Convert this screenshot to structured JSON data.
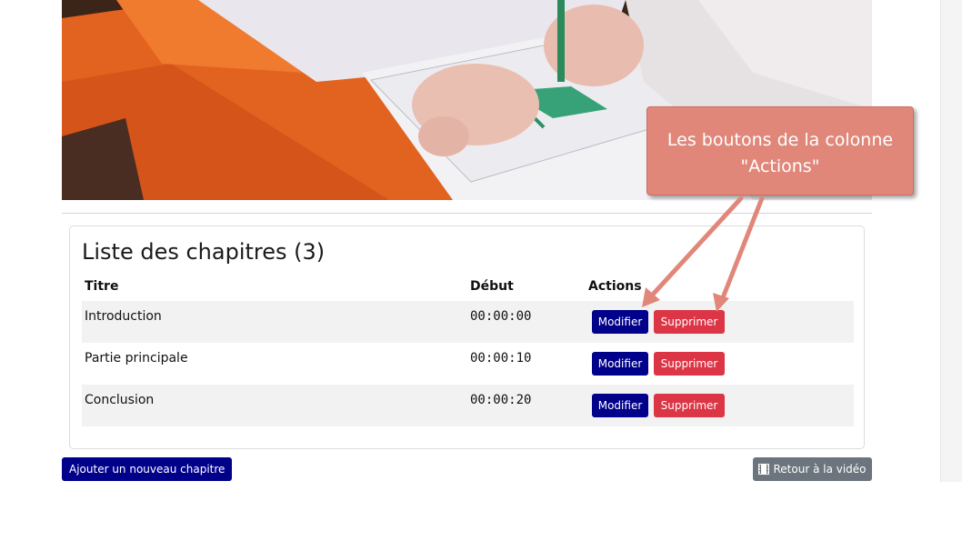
{
  "chapters": {
    "title": "Liste des chapitres (3)",
    "headers": {
      "title": "Titre",
      "start": "Début",
      "actions": "Actions"
    },
    "rows": [
      {
        "title": "Introduction",
        "start": "00:00:00",
        "edit": "Modifier",
        "delete": "Supprimer"
      },
      {
        "title": "Partie principale",
        "start": "00:00:10",
        "edit": "Modifier",
        "delete": "Supprimer"
      },
      {
        "title": "Conclusion",
        "start": "00:00:20",
        "edit": "Modifier",
        "delete": "Supprimer"
      }
    ]
  },
  "footer": {
    "add_label": "Ajouter un nouveau chapitre",
    "back_label": "Retour à la vidéo",
    "back_icon": "film-icon"
  },
  "annotation": {
    "line1": "Les boutons de la colonne",
    "line2": "\"Actions\""
  },
  "colors": {
    "primary": "#00008b",
    "danger": "#dc3545",
    "secondary": "#6c757d",
    "callout": "#e0877a"
  }
}
